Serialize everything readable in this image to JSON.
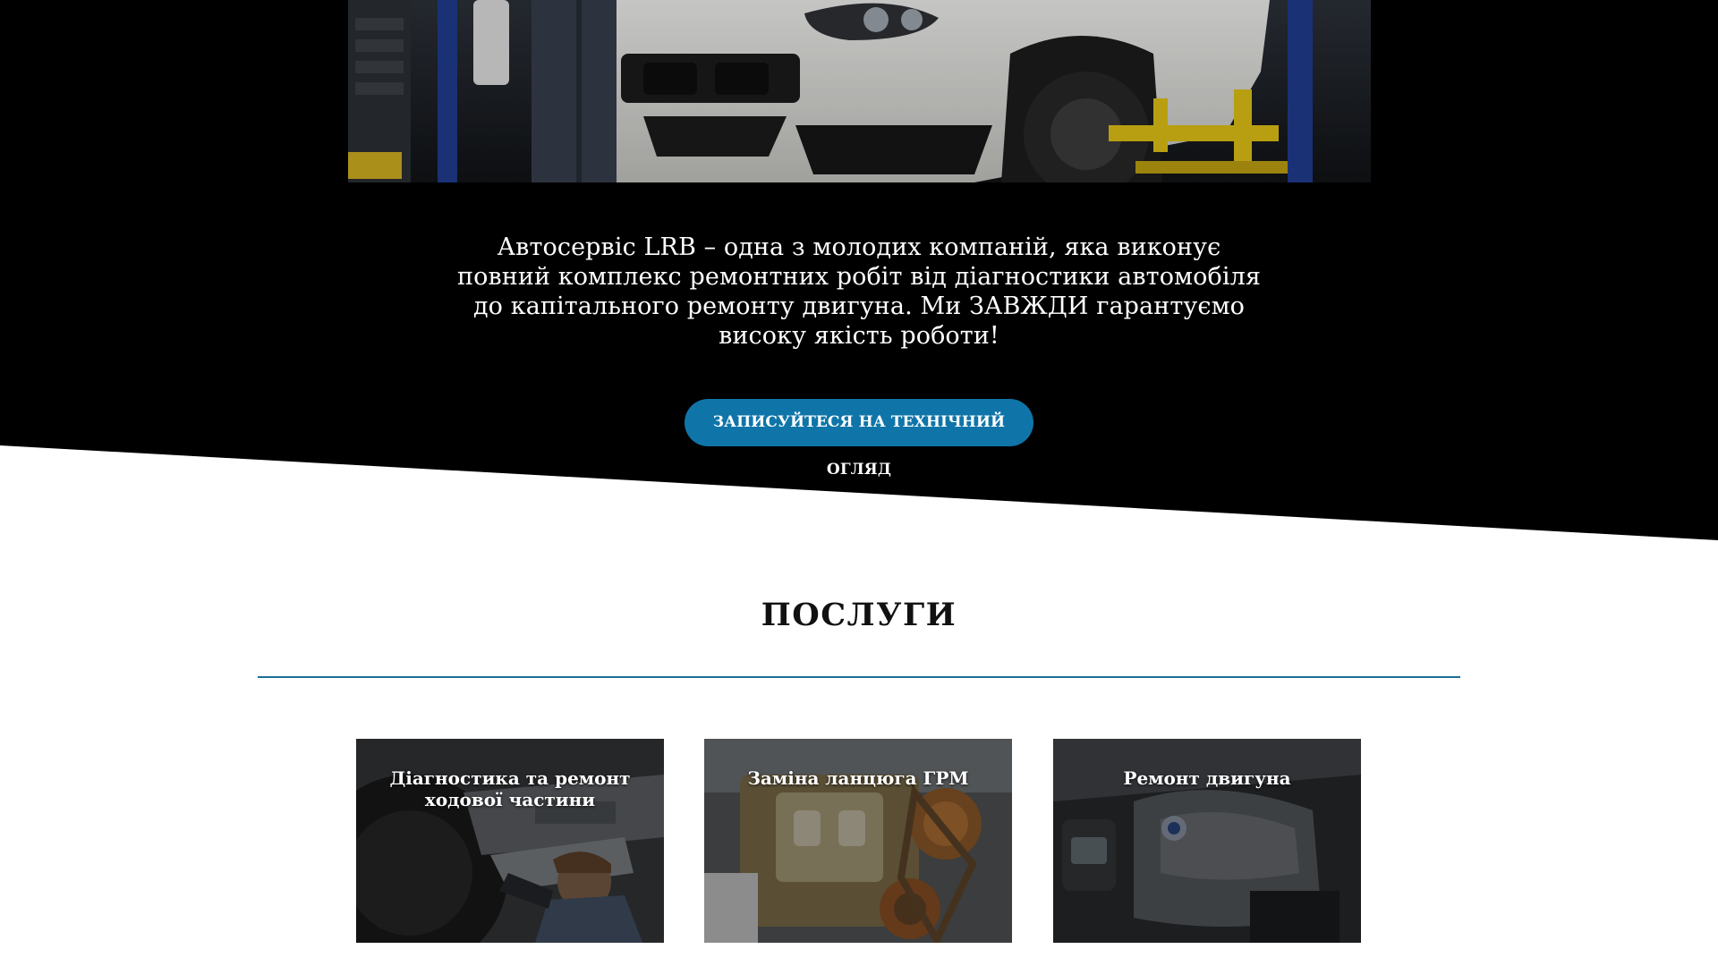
{
  "hero": {
    "description": "Автосервіс LRB – одна з молодих компаній, яка виконує повний комплекс ремонтних робіт від діагностики автомобіля до капітального ремонту двигуна. Ми ЗАВЖДИ гарантуємо високу якість роботи!",
    "cta_label": "ЗАПИСУЙТЕСЯ НА ТЕХНІЧНИЙ ОГЛЯД",
    "accent_color": "#0f75a8",
    "background_color": "#000000"
  },
  "services": {
    "title": "ПОСЛУГИ",
    "divider_color": "#1b6f95",
    "items": [
      {
        "title": "Діагностика та ремонт ходової частини",
        "icon": "mechanic-under-car-photo"
      },
      {
        "title": "Заміна ланцюга ГРМ",
        "icon": "timing-chain-engine-photo"
      },
      {
        "title": "Ремонт двигуна",
        "icon": "engine-bay-photo"
      }
    ]
  }
}
